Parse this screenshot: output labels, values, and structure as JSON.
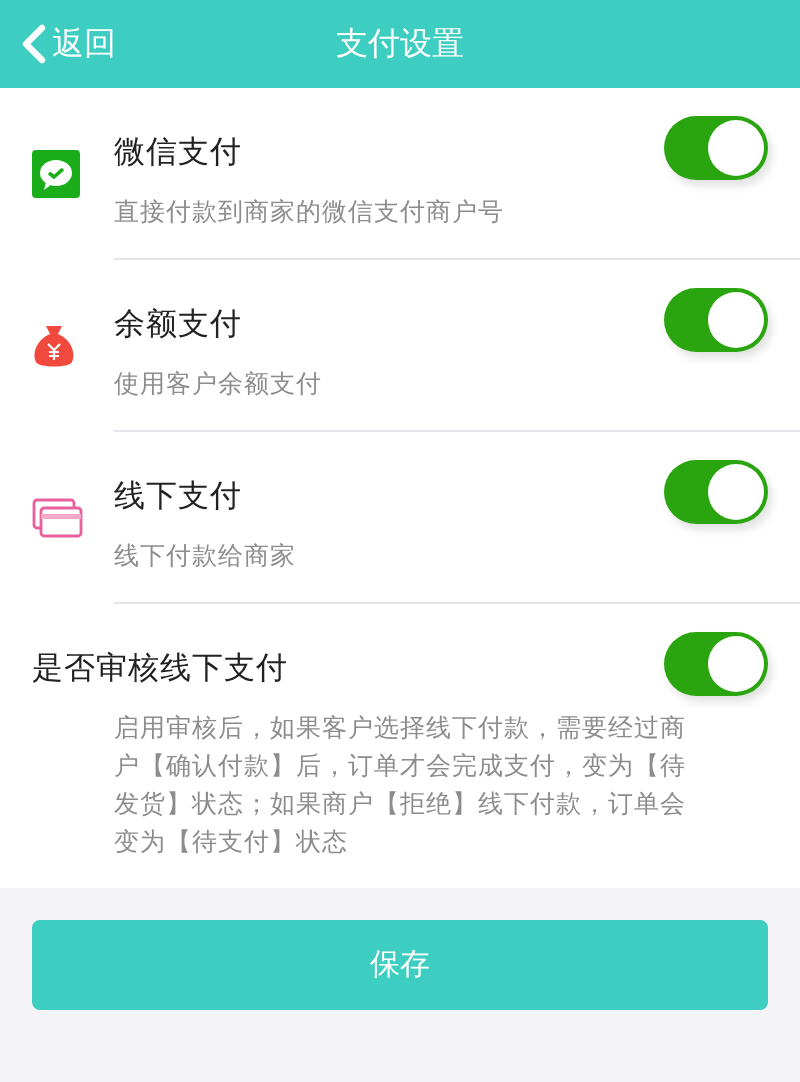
{
  "header": {
    "back": "返回",
    "title": "支付设置"
  },
  "items": [
    {
      "kind": "wechat",
      "title": "微信支付",
      "description": "直接付款到商家的微信支付商户号",
      "on": true
    },
    {
      "kind": "balance",
      "title": "余额支付",
      "description": "使用客户余额支付",
      "on": true
    },
    {
      "kind": "offline",
      "title": "线下支付",
      "description": "线下付款给商家",
      "on": true
    },
    {
      "kind": "setting",
      "title": "是否审核线下支付",
      "description": "启用审核后，如果客户选择线下付款，需要经过商户【确认付款】后，订单才会完成支付，变为【待发货】状态；如果商户【拒绝】线下付款，订单会变为【待支付】状态",
      "on": true
    }
  ],
  "save_button": "保存"
}
